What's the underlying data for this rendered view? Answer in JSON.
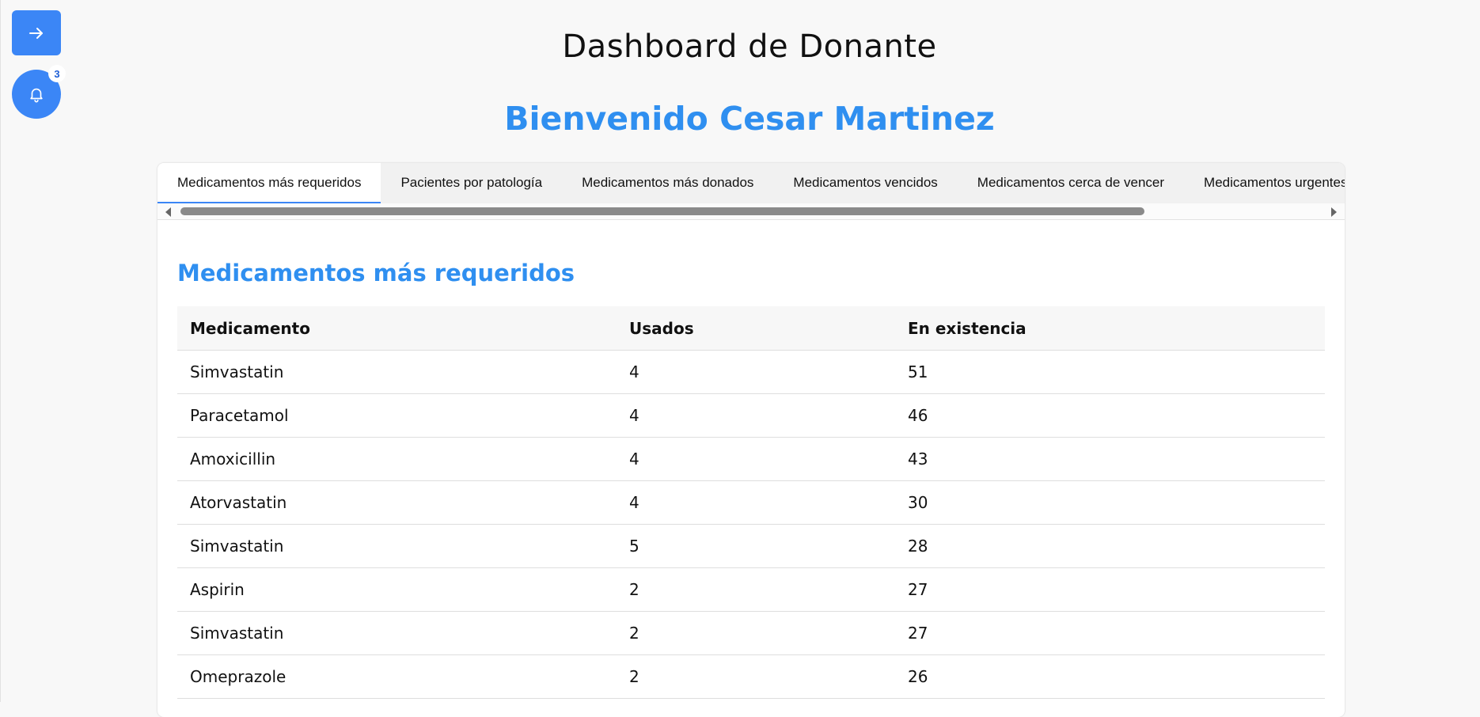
{
  "header": {
    "title": "Dashboard de Donante",
    "welcome": "Bienvenido Cesar Martinez"
  },
  "sidebar": {
    "expand_icon": "arrow-right-icon",
    "bell_icon": "bell-icon",
    "notification_count": "3"
  },
  "tabs": [
    {
      "label": "Medicamentos más requeridos",
      "active": true
    },
    {
      "label": "Pacientes por patología",
      "active": false
    },
    {
      "label": "Medicamentos más donados",
      "active": false
    },
    {
      "label": "Medicamentos vencidos",
      "active": false
    },
    {
      "label": "Medicamentos cerca de vencer",
      "active": false
    },
    {
      "label": "Medicamentos urgentes",
      "active": false
    }
  ],
  "section": {
    "title": "Medicamentos más requeridos"
  },
  "table": {
    "columns": [
      "Medicamento",
      "Usados",
      "En existencia"
    ],
    "rows": [
      [
        "Simvastatin",
        "4",
        "51"
      ],
      [
        "Paracetamol",
        "4",
        "46"
      ],
      [
        "Amoxicillin",
        "4",
        "43"
      ],
      [
        "Atorvastatin",
        "4",
        "30"
      ],
      [
        "Simvastatin",
        "5",
        "28"
      ],
      [
        "Aspirin",
        "2",
        "27"
      ],
      [
        "Simvastatin",
        "2",
        "27"
      ],
      [
        "Omeprazole",
        "2",
        "26"
      ]
    ]
  },
  "colors": {
    "accent": "#3b86f6",
    "heading_blue": "#2f8ff0"
  }
}
